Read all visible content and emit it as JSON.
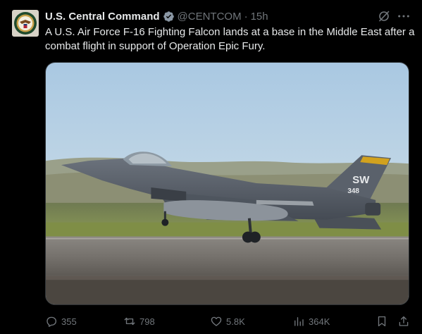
{
  "tweet": {
    "display_name": "U.S. Central Command",
    "handle": "@CENTCOM",
    "separator": "·",
    "time": "15h",
    "text": "A U.S. Air Force F-16 Fighting Falcon lands at a base in the Middle East after a combat flight in support of Operation Epic Fury.",
    "avatar_icon": "centcom-seal-icon",
    "verified_icon": "verified-badge-icon",
    "verified_color": "#8b98a5"
  },
  "media": {
    "tail_text": "SW",
    "tail_number": "348"
  },
  "actions": {
    "replies": "355",
    "reposts": "798",
    "likes": "5.8K",
    "views": "364K"
  },
  "colors": {
    "background": "#000000",
    "primary_text": "#e7e9ea",
    "secondary_text": "#71767b"
  }
}
